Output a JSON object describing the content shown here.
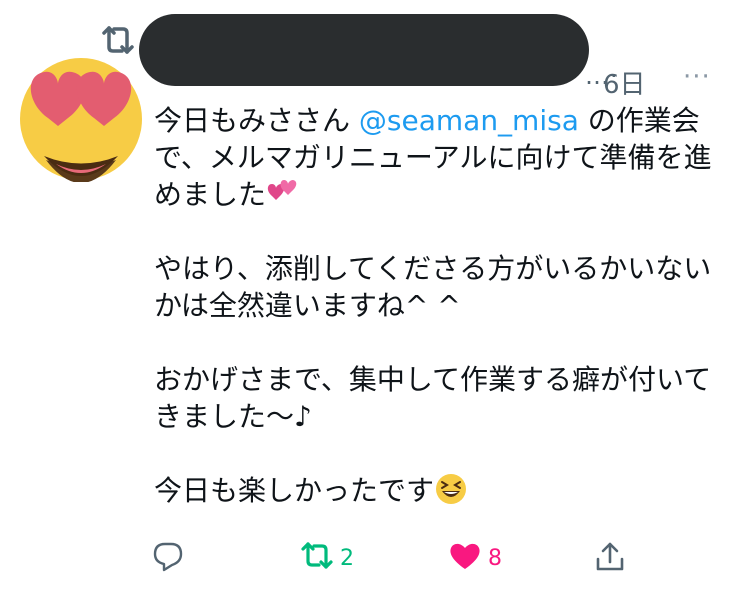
{
  "tweet": {
    "header": {
      "retweet_icon": "retweet-icon",
      "dots": "…·",
      "time": "6日",
      "more": "···"
    },
    "body": {
      "line1_prefix": "今日もみささん ",
      "mention": "@seaman_misa",
      "line1_suffix": " の作業会",
      "line2": "で、メルマガリニューアルに向けて準備を進",
      "line3": "めました",
      "line4": "やはり、添削してくださる方がいるかいない",
      "line5": "かは全然違いますね^ ^",
      "line6": "おかげさまで、集中して作業する癖が付いて",
      "line7": "きました〜♪",
      "line8": "今日も楽しかったです"
    },
    "actions": {
      "reply_icon": "reply-icon",
      "retweet_count": "2",
      "like_count": "8",
      "share_icon": "share-icon"
    },
    "colors": {
      "mention": "#1d9bf0",
      "retweet": "#00ba7c",
      "like": "#f91880",
      "muted": "#536471"
    }
  }
}
